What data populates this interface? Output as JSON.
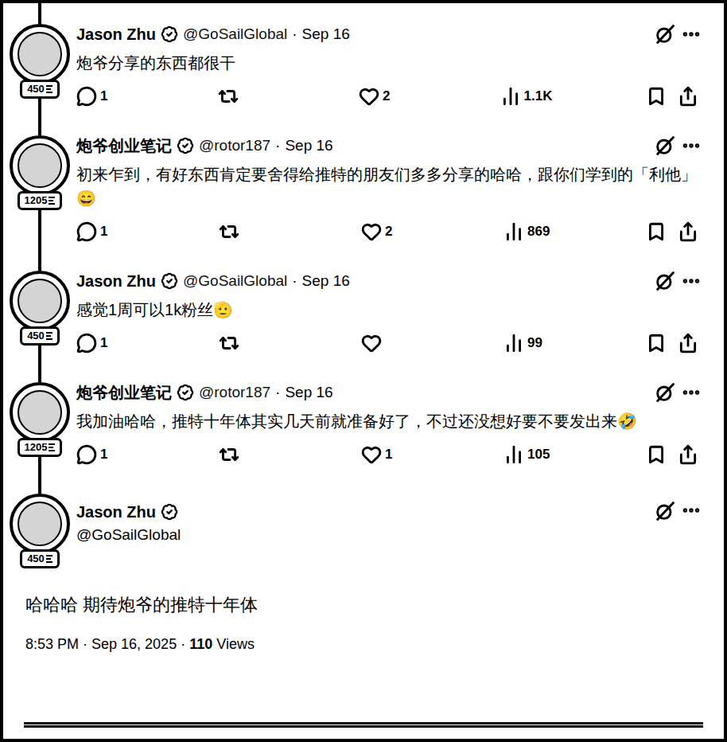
{
  "thread": [
    {
      "author": "Jason Zhu",
      "verified": true,
      "handle": "@GoSailGlobal",
      "separator": "·",
      "time": "Sep 16",
      "badge": "450",
      "text": "炮爷分享的东西都很干",
      "replies": "1",
      "likes": "2",
      "views": "1.1K"
    },
    {
      "author": "炮爷创业笔记",
      "verified": true,
      "handle": "@rotor187",
      "separator": "·",
      "time": "Sep 16",
      "badge": "1205",
      "text": "初来乍到，有好东西肯定要舍得给推特的朋友们多多分享的哈哈，跟你们学到的「利他」😄",
      "replies": "1",
      "likes": "2",
      "views": "869"
    },
    {
      "author": "Jason Zhu",
      "verified": true,
      "handle": "@GoSailGlobal",
      "separator": "·",
      "time": "Sep 16",
      "badge": "450",
      "text": "感觉1周可以1k粉丝🫡",
      "replies": "1",
      "likes": "",
      "views": "99"
    },
    {
      "author": "炮爷创业笔记",
      "verified": true,
      "handle": "@rotor187",
      "separator": "·",
      "time": "Sep 16",
      "badge": "1205",
      "text": "我加油哈哈，推特十年体其实几天前就准备好了，不过还没想好要不要发出来🤣",
      "replies": "1",
      "likes": "1",
      "views": "105"
    }
  ],
  "focal": {
    "author": "Jason Zhu",
    "verified": true,
    "handle": "@GoSailGlobal",
    "badge": "450",
    "text": "哈哈哈 期待炮爷的推特十年体",
    "time": "8:53 PM",
    "separator": "·",
    "date": "Sep 16, 2025",
    "views": "110",
    "views_label": "Views"
  }
}
